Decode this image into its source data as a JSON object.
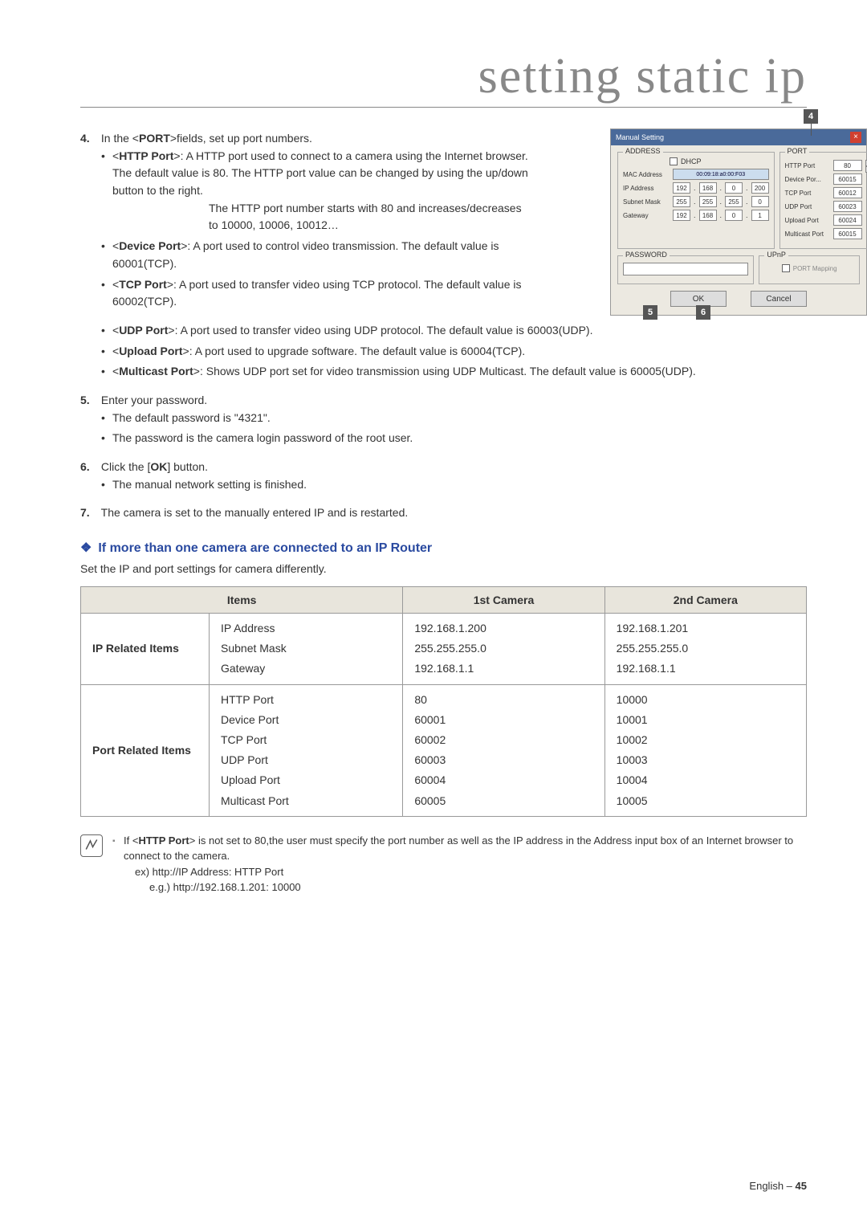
{
  "title": "setting static ip",
  "dialog": {
    "title": "Manual Setting",
    "close_label": "×",
    "address_legend": "ADDRESS",
    "dhcp_label": "DHCP",
    "mac_label": "MAC Address",
    "mac_value": "00:09:18:a0:00:F03",
    "ip_label": "IP Address",
    "ip_octets": [
      "192",
      "168",
      "0",
      "200"
    ],
    "subnet_label": "Subnet Mask",
    "subnet_octets": [
      "255",
      "255",
      "255",
      "0"
    ],
    "gateway_label": "Gateway",
    "gateway_octets": [
      "192",
      "168",
      "0",
      "1"
    ],
    "port_legend": "PORT",
    "ports": [
      {
        "label": "HTTP Port",
        "value": "80"
      },
      {
        "label": "Device Por...",
        "value": "60015"
      },
      {
        "label": "TCP Port",
        "value": "60012"
      },
      {
        "label": "UDP Port",
        "value": "60023"
      },
      {
        "label": "Upload Port",
        "value": "60024"
      },
      {
        "label": "Multicast Port",
        "value": "60015"
      }
    ],
    "password_legend": "PASSWORD",
    "upnp_legend": "UPnP",
    "port_mapping_label": "PORT Mapping",
    "ok_label": "OK",
    "cancel_label": "Cancel",
    "callout_4": "4",
    "callout_5": "5",
    "callout_6": "6"
  },
  "steps": {
    "n4": "4.",
    "s4_intro": "In the <PORT>fields, set up port numbers.",
    "http_term": "HTTP Port",
    "http_text": ": A HTTP port used to connect to a camera using the Internet browser. The default value is 80. The HTTP port value can be changed by using the up/down button to the right.",
    "http_extra1": "The HTTP port number starts with 80 and increases/decreases to 10000, 10006, 10012…",
    "device_term": "Device Port",
    "device_text": ": A port used to control video transmission. The default value is 60001(TCP).",
    "tcp_term": "TCP Port",
    "tcp_text": ": A port used to transfer video using TCP protocol. The default value is 60002(TCP).",
    "udp_term": "UDP Port",
    "udp_text": ": A port used to transfer video using UDP protocol. The default value is 60003(UDP).",
    "upload_term": "Upload Port",
    "upload_text": ": A port used to upgrade software. The default value is 60004(TCP).",
    "multicast_term": "Multicast Port",
    "multicast_text": ": Shows UDP port set for video transmission using UDP Multicast. The default value is 60005(UDP).",
    "n5": "5.",
    "s5_intro": "Enter your password.",
    "s5_b1": "The default password is \"4321\".",
    "s5_b2": "The password is the camera login password of the root user.",
    "n6": "6.",
    "s6_intro_a": "Click the [",
    "s6_ok": "OK",
    "s6_intro_b": "] button.",
    "s6_b1": "The manual network setting is finished.",
    "n7": "7.",
    "s7_intro": "The camera is set to the manually entered IP and is restarted."
  },
  "section": {
    "heading": "If more than one camera are connected to an IP Router",
    "intro": "Set the IP and port settings for camera differently."
  },
  "table": {
    "h_items": "Items",
    "h_cam1": "1st Camera",
    "h_cam2": "2nd Camera",
    "r1_head": "IP Related Items",
    "r1_labels": [
      "IP Address",
      "Subnet Mask",
      "Gateway"
    ],
    "r1_cam1": [
      "192.168.1.200",
      "255.255.255.0",
      "192.168.1.1"
    ],
    "r1_cam2": [
      "192.168.1.201",
      "255.255.255.0",
      "192.168.1.1"
    ],
    "r2_head": "Port Related Items",
    "r2_labels": [
      "HTTP Port",
      "Device Port",
      "TCP Port",
      "UDP Port",
      "Upload Port",
      "Multicast Port"
    ],
    "r2_cam1": [
      "80",
      "60001",
      "60002",
      "60003",
      "60004",
      "60005"
    ],
    "r2_cam2": [
      "10000",
      "10001",
      "10002",
      "10003",
      "10004",
      "10005"
    ]
  },
  "note": {
    "main_a": "If <",
    "main_term": "HTTP Port",
    "main_b": "> is not set to 80,the user must specify the port number as well as the IP address in the Address input box of an Internet browser to connect to the camera.",
    "line2": "ex) http://IP Address: HTTP Port",
    "line3": "e.g.) http://192.168.1.201: 10000"
  },
  "footer": {
    "lang": "English –",
    "page": "45"
  }
}
